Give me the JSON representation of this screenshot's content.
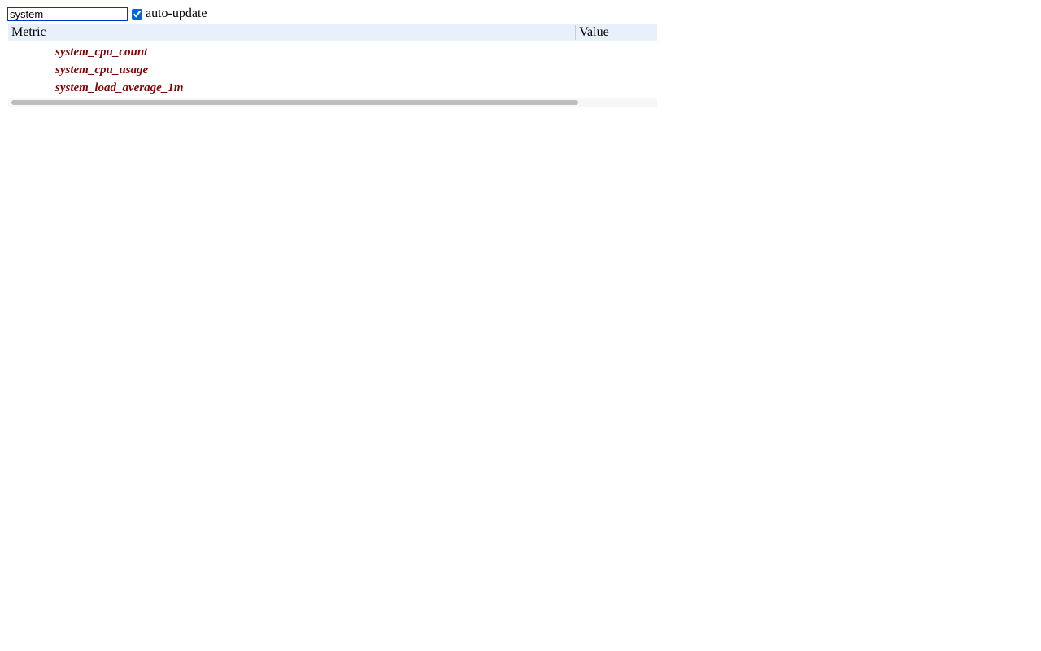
{
  "search": {
    "value": "system"
  },
  "checkbox": {
    "label": "auto-update",
    "checked": true
  },
  "table": {
    "headers": {
      "metric": "Metric",
      "value": "Value"
    },
    "rows": [
      {
        "name": "system_cpu_count"
      },
      {
        "name": "system_cpu_usage"
      },
      {
        "name": "system_load_average_1m"
      }
    ]
  },
  "progress": {
    "percent": 88
  }
}
